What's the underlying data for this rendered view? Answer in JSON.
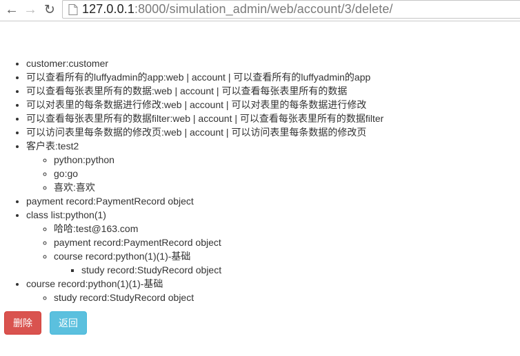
{
  "browser": {
    "url_host": "127.0.0.1",
    "url_rest": ":8000/simulation_admin/web/account/3/delete/"
  },
  "items": [
    {
      "text": "customer:customer"
    },
    {
      "text": "可以查看所有的luffyadmin的app:web | account | 可以查看所有的luffyadmin的app"
    },
    {
      "text": "可以查看每张表里所有的数据:web | account | 可以查看每张表里所有的数据"
    },
    {
      "text": "可以对表里的每条数据进行修改:web | account | 可以对表里的每条数据进行修改"
    },
    {
      "text": "可以查看每张表里所有的数据filter:web | account | 可以查看每张表里所有的数据filter"
    },
    {
      "text": "可以访问表里每条数据的修改页:web | account | 可以访问表里每条数据的修改页"
    },
    {
      "text": "客户表:test2",
      "children": [
        {
          "text": "python:python"
        },
        {
          "text": "go:go"
        },
        {
          "text": "喜欢:喜欢"
        }
      ]
    },
    {
      "text": "payment record:PaymentRecord object"
    },
    {
      "text": "class list:python(1)",
      "children": [
        {
          "text": "哈哈:test@163.com"
        },
        {
          "text": "payment record:PaymentRecord object"
        },
        {
          "text": "course record:python(1)(1)-基础",
          "children": [
            {
              "text": "study record:StudyRecord object"
            }
          ]
        }
      ]
    },
    {
      "text": "course record:python(1)(1)-基础",
      "children": [
        {
          "text": "study record:StudyRecord object"
        }
      ]
    }
  ],
  "buttons": {
    "delete_label": "删除",
    "back_label": "返回"
  },
  "colors": {
    "danger": "#d9534f",
    "info": "#5bc0de",
    "text": "#333333"
  },
  "icons": [
    "back-arrow-icon",
    "forward-arrow-icon",
    "reload-icon",
    "page-icon"
  ]
}
